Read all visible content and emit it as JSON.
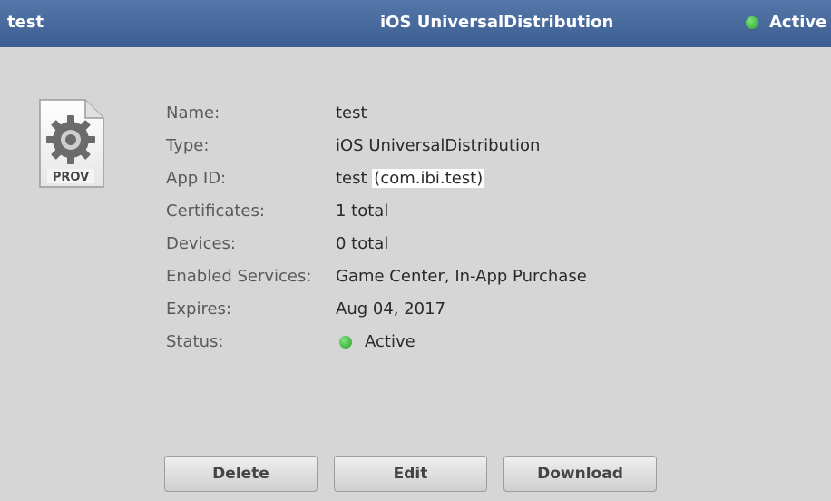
{
  "header": {
    "left_title": "test",
    "center_title": "iOS UniversalDistribution",
    "status": "Active",
    "status_color": "#2aa12a"
  },
  "icon": {
    "name": "provisioning-profile-icon",
    "label": "PROV"
  },
  "details": [
    {
      "label": "Name:",
      "value": "test"
    },
    {
      "label": "Type:",
      "value": "iOS UniversalDistribution"
    },
    {
      "label": "App ID:",
      "value_prefix": "test ",
      "value_highlight": "(com.ibi.test)"
    },
    {
      "label": "Certificates:",
      "value": "1 total"
    },
    {
      "label": "Devices:",
      "value": "0 total"
    },
    {
      "label": "Enabled Services:",
      "value": "Game Center, In-App Purchase"
    },
    {
      "label": "Expires:",
      "value": "Aug 04, 2017"
    },
    {
      "label": "Status:",
      "value": "Active"
    }
  ],
  "buttons": {
    "delete": "Delete",
    "edit": "Edit",
    "download": "Download"
  }
}
